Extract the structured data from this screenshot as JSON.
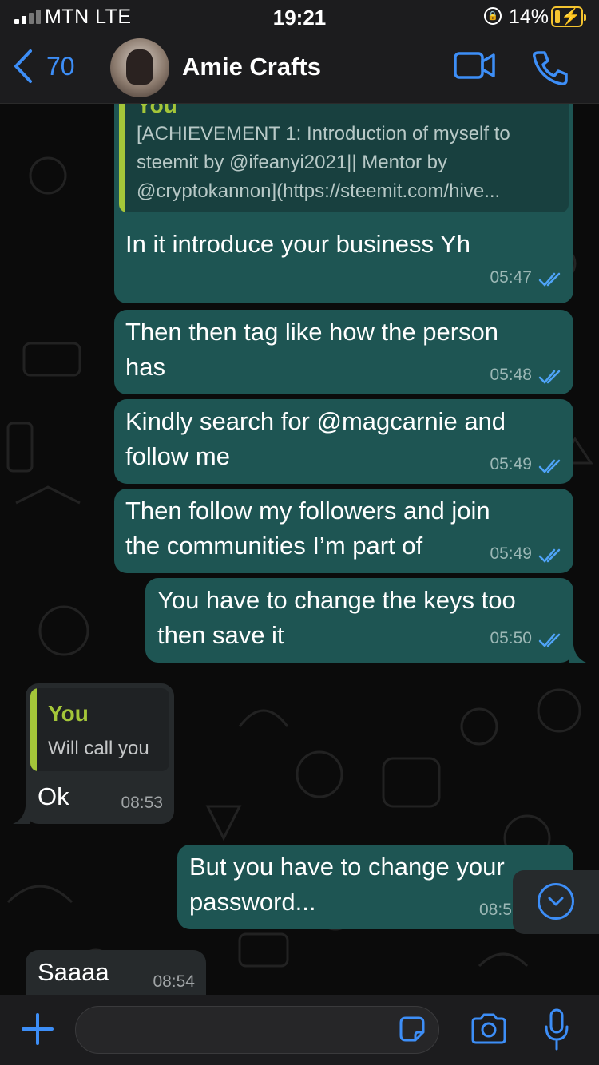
{
  "status_bar": {
    "carrier": "MTN  LTE",
    "time": "19:21",
    "battery_percent": "14%",
    "battery_level": 0.14,
    "battery_color": "#f4c430"
  },
  "header": {
    "back_count": "70",
    "contact_name": "Amie Crafts",
    "icons": [
      "back-chevron-icon",
      "video-call-icon",
      "phone-call-icon"
    ],
    "accent_color": "#3d8ef7"
  },
  "messages": [
    {
      "direction": "outgoing",
      "quote": {
        "author": "You",
        "lines": [
          "[ACHIEVEMENT 1: Introduction of myself to",
          "steemit by @ifeanyi2021|| Mentor by",
          "@cryptokannon](https://steemit.com/hive..."
        ]
      },
      "text": "In it introduce your business Yh",
      "time": "05:47",
      "status": "read"
    },
    {
      "direction": "outgoing",
      "lines": [
        "Then then tag like how the person",
        "has"
      ],
      "time": "05:48",
      "status": "read"
    },
    {
      "direction": "outgoing",
      "lines": [
        "Kindly search for @magcarnie and",
        "follow me"
      ],
      "time": "05:49",
      "status": "read"
    },
    {
      "direction": "outgoing",
      "lines": [
        "Then follow my followers and join",
        "the communities I’m part of"
      ],
      "time": "05:49",
      "status": "read"
    },
    {
      "direction": "outgoing",
      "lines": [
        "You have to change the keys too",
        "then save it"
      ],
      "time": "05:50",
      "status": "read"
    },
    {
      "direction": "incoming",
      "quote": {
        "author": "You",
        "text": "Will call you"
      },
      "text": "Ok",
      "time": "08:53"
    },
    {
      "direction": "outgoing",
      "lines": [
        "But you have to change your",
        "password..."
      ],
      "time": "08:5",
      "status": "read"
    },
    {
      "direction": "incoming",
      "text": "Saaaa",
      "time": "08:54"
    }
  ],
  "colors": {
    "outgoing_bubble": "#1e5553",
    "incoming_bubble": "#262a2c",
    "quote_bar": "#a4c639",
    "read_tick": "#4fa3f7"
  },
  "input_bar": {
    "placeholder": "",
    "icons": [
      "plus-icon",
      "sticker-icon",
      "camera-icon",
      "microphone-icon"
    ]
  },
  "scroll_button_icon": "chevron-down-circle-icon"
}
